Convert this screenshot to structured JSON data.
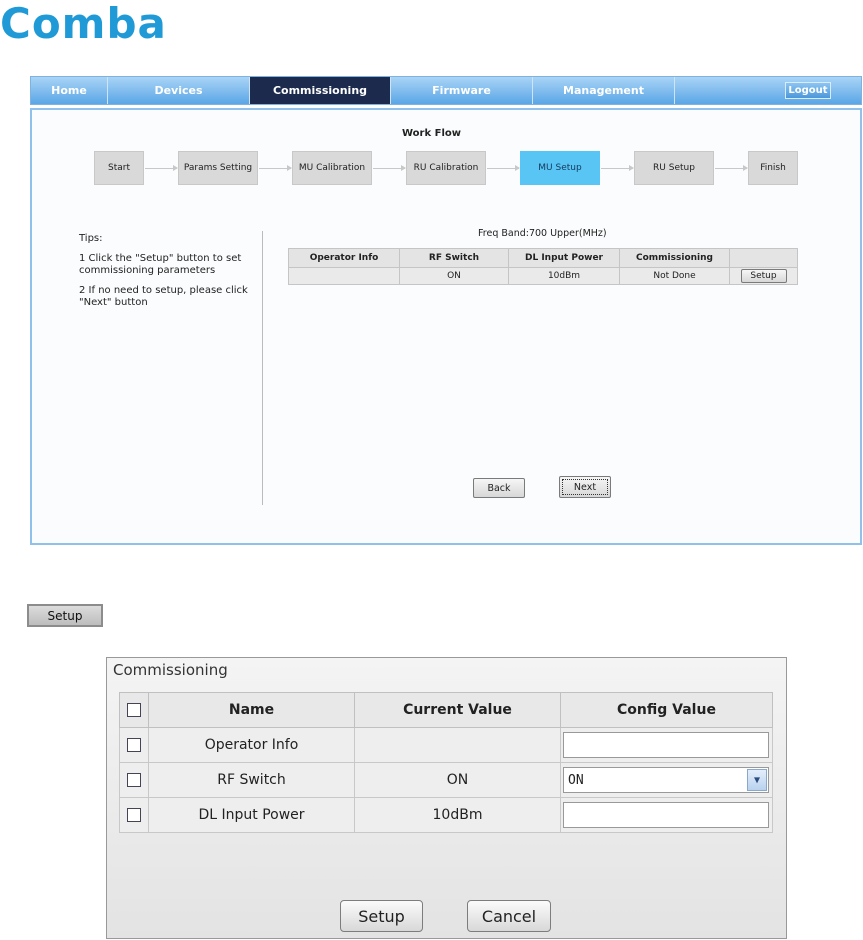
{
  "brand": {
    "logo_text": "Comba",
    "color": "#1f9ad6"
  },
  "nav": {
    "tabs": [
      {
        "label": "Home"
      },
      {
        "label": "Devices"
      },
      {
        "label": "Commissioning",
        "active": true
      },
      {
        "label": "Firmware"
      },
      {
        "label": "Management"
      }
    ],
    "logout_label": "Logout"
  },
  "workflow": {
    "title": "Work Flow",
    "steps": [
      "Start",
      "Params Setting",
      "MU Calibration",
      "RU Calibration",
      "MU Setup",
      "RU Setup",
      "Finish"
    ],
    "active_step": "MU Setup"
  },
  "tips": {
    "heading": "Tips:",
    "items": [
      "1 Click the \"Setup\" button to set commissioning parameters",
      "2 If no need to setup, please click \"Next\" button"
    ]
  },
  "freq_band": "Freq Band:700 Upper(MHz)",
  "main_table": {
    "headers": [
      "Operator Info",
      "RF Switch",
      "DL Input Power",
      "Commissioning",
      ""
    ],
    "rows": [
      {
        "operator_info": "",
        "rf_switch": "ON",
        "dl_input_power": "10dBm",
        "commissioning": "Not Done",
        "action": "Setup"
      }
    ]
  },
  "buttons": {
    "back": "Back",
    "next": "Next"
  },
  "setup_button_example": "Setup",
  "dialog": {
    "title": "Commissioning",
    "headers": [
      "Name",
      "Current Value",
      "Config Value"
    ],
    "rows": [
      {
        "name": "Operator Info",
        "current": "",
        "config": ""
      },
      {
        "name": "RF Switch",
        "current": "ON",
        "config": "ON"
      },
      {
        "name": "DL Input Power",
        "current": "10dBm",
        "config": ""
      }
    ],
    "setup_label": "Setup",
    "cancel_label": "Cancel"
  }
}
